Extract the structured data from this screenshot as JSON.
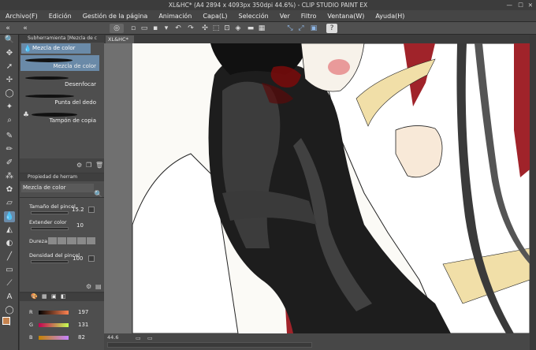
{
  "window": {
    "title": "XL&HC* (A4 2894 x 4093px 350dpi 44.6%) - CLIP STUDIO PAINT EX"
  },
  "menu": [
    "Archivo(F)",
    "Edición",
    "Gestión de la página",
    "Animación",
    "Capa(L)",
    "Selección",
    "Ver",
    "Filtro",
    "Ventana(W)",
    "Ayuda(H)"
  ],
  "subtool_panel": {
    "title": "Subherramienta [Mezcla de c",
    "tab": "Mezcla de color",
    "items": [
      {
        "label": "Mezcla de color",
        "selected": true
      },
      {
        "label": "Desenfocar",
        "selected": false
      },
      {
        "label": "Punta del dedo",
        "selected": false
      },
      {
        "label": "Tampón de copia",
        "selected": false
      }
    ]
  },
  "property_panel": {
    "title": "Propiedad de herram",
    "tool_name": "Mezcla de color",
    "brush_size": {
      "label": "Tamaño del pincel",
      "value": "15.2"
    },
    "extend_color": {
      "label": "Extender color",
      "value": "10"
    },
    "hardness": {
      "label": "Dureza"
    },
    "brush_density": {
      "label": "Densidad del pincel",
      "value": "100"
    }
  },
  "color_panel": {
    "channels": [
      {
        "label": "R",
        "value": "197"
      },
      {
        "label": "G",
        "value": "131"
      },
      {
        "label": "B",
        "value": "82"
      }
    ],
    "main_color": "#c5834f"
  },
  "canvas": {
    "tab_label": "XL&HC*"
  },
  "status": {
    "zoom": "44.6"
  }
}
